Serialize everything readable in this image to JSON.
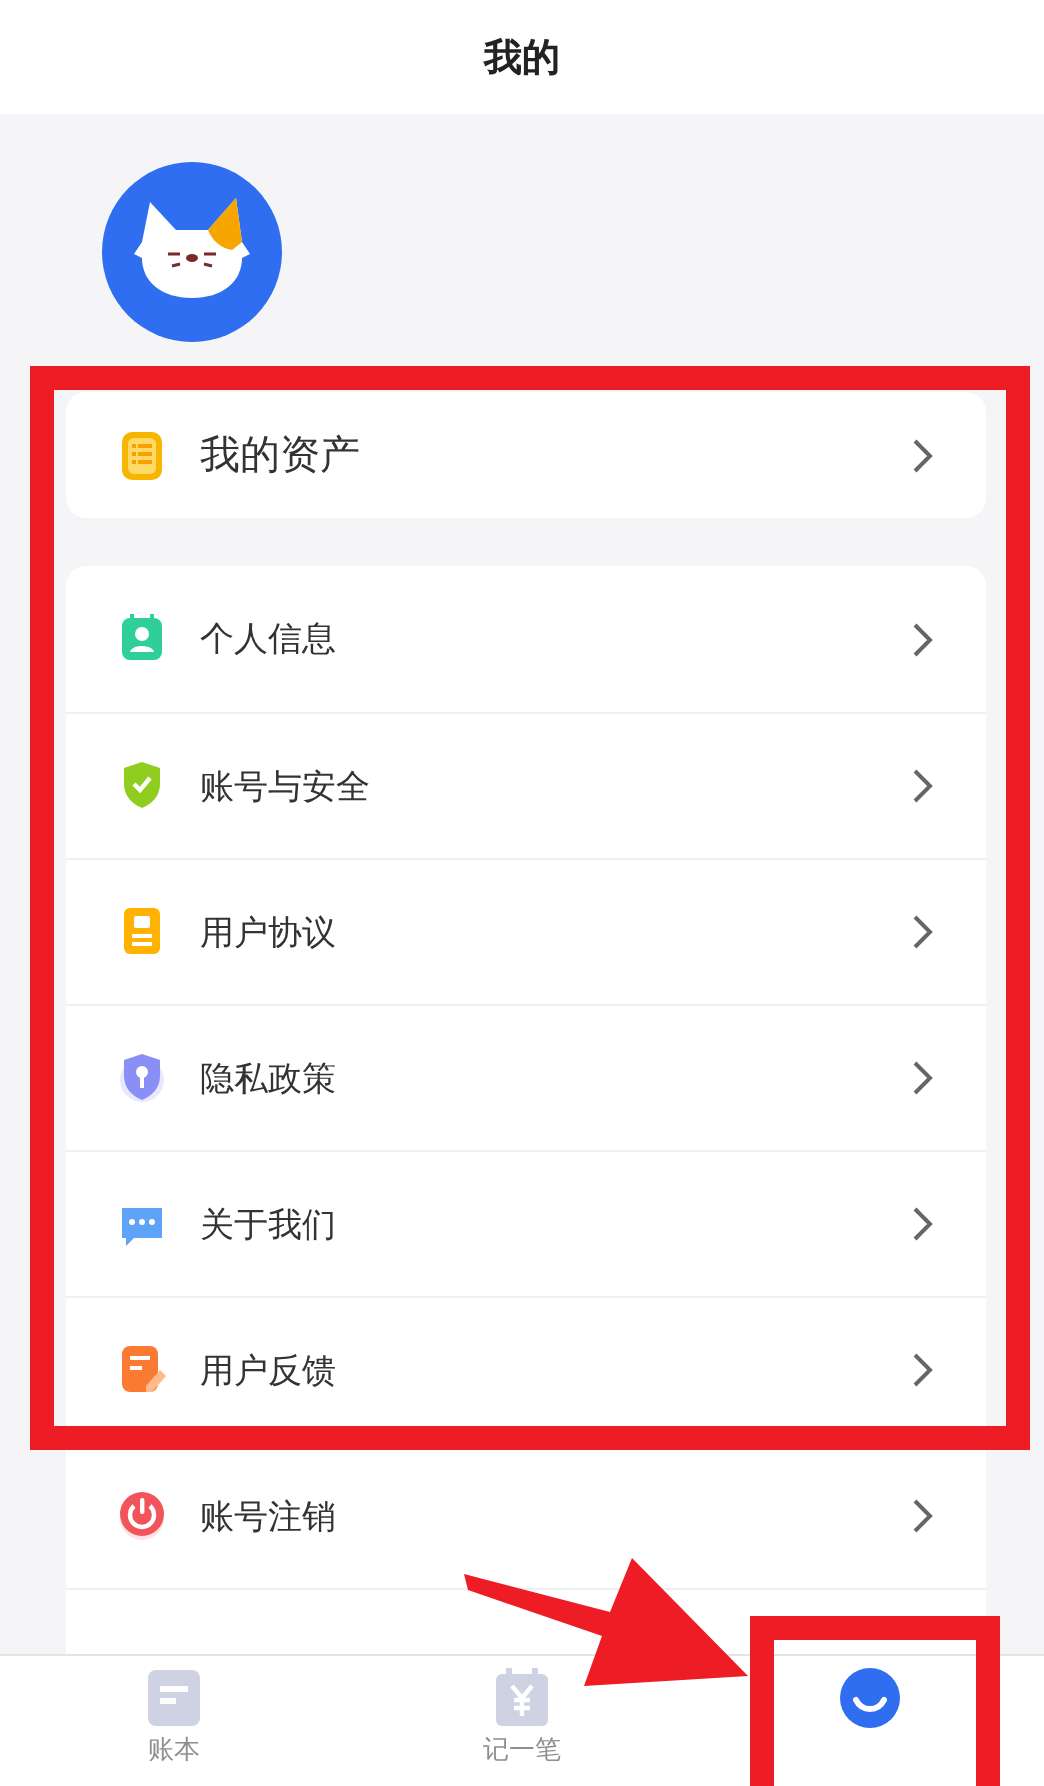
{
  "header": {
    "title": "我的"
  },
  "groups": [
    {
      "items": [
        {
          "kind": "assets",
          "label": "我的资产"
        }
      ]
    },
    {
      "items": [
        {
          "kind": "profile",
          "label": "个人信息"
        },
        {
          "kind": "security",
          "label": "账号与安全"
        },
        {
          "kind": "agreement",
          "label": "用户协议"
        },
        {
          "kind": "privacy",
          "label": "隐私政策"
        },
        {
          "kind": "about",
          "label": "关于我们"
        },
        {
          "kind": "feedback",
          "label": "用户反馈"
        },
        {
          "kind": "cancel",
          "label": "账号注销"
        }
      ]
    }
  ],
  "tabs": [
    {
      "kind": "ledger",
      "label": "账本",
      "selected": false
    },
    {
      "kind": "record",
      "label": "记一笔",
      "selected": false
    },
    {
      "kind": "mine",
      "selected": true
    }
  ],
  "annotations": [
    {
      "kind": "box"
    },
    {
      "kind": "box"
    },
    {
      "kind": "arrow"
    }
  ]
}
